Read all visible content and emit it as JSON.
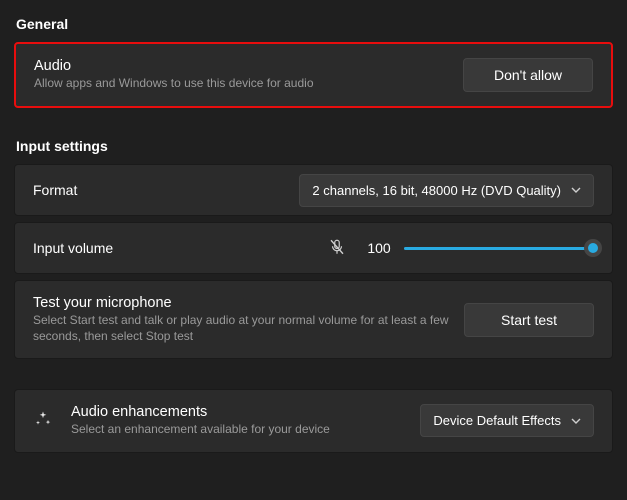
{
  "general": {
    "heading": "General",
    "audio": {
      "title": "Audio",
      "subtitle": "Allow apps and Windows to use this device for audio",
      "button": "Don't allow"
    }
  },
  "input": {
    "heading": "Input settings",
    "format": {
      "label": "Format",
      "value": "2 channels, 16 bit, 48000 Hz (DVD Quality)"
    },
    "volume": {
      "label": "Input volume",
      "value": "100"
    },
    "test": {
      "title": "Test your microphone",
      "subtitle": "Select Start test and talk or play audio at your normal volume for at least a few seconds, then select Stop test",
      "button": "Start test"
    }
  },
  "enhancements": {
    "title": "Audio enhancements",
    "subtitle": "Select an enhancement available for your device",
    "dropdown": "Device Default Effects"
  }
}
